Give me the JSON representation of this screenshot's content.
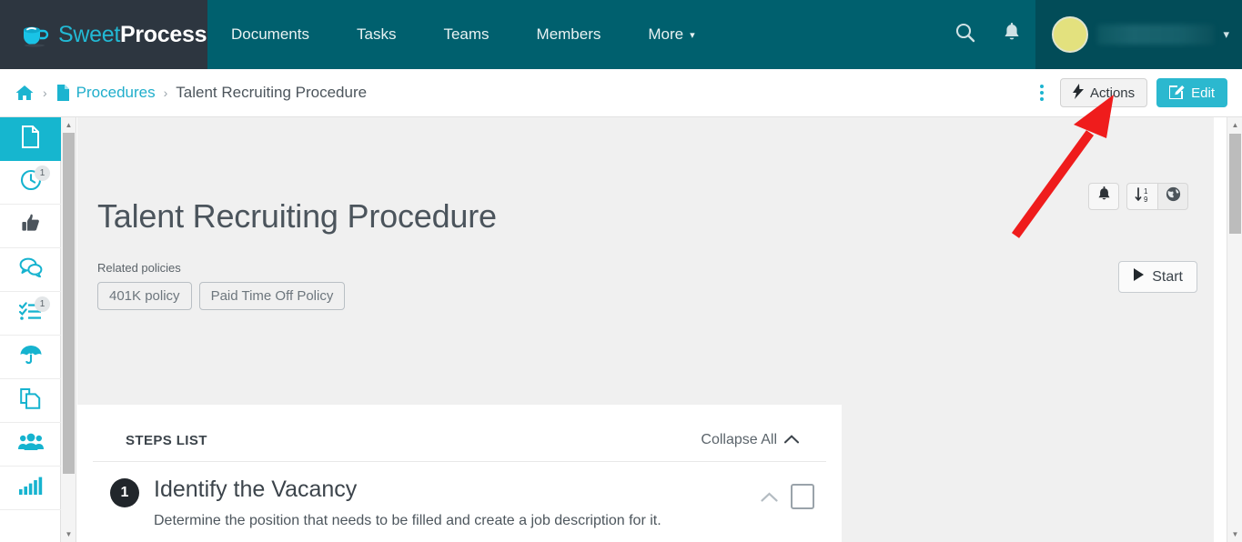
{
  "brand": {
    "logo_icon": "coffee-cup-icon",
    "name_part1": "Sweet",
    "name_part2": "Process",
    "accent_teal": "#00606e",
    "accent_cyan": "#22b9d4",
    "logo_bg": "#2d3640"
  },
  "topnav": {
    "items": [
      {
        "label": "Documents"
      },
      {
        "label": "Tasks"
      },
      {
        "label": "Teams"
      },
      {
        "label": "Members"
      },
      {
        "label": "More",
        "has_chevron": true,
        "chevron": "▾"
      }
    ],
    "search_icon": "search-icon",
    "notifications_icon": "bell-icon",
    "user": {
      "avatar_color": "#e3e17e",
      "name": "",
      "name_redacted": true,
      "chevron": "▾"
    }
  },
  "breadcrumb": {
    "home_icon": "home-icon",
    "separator": "›",
    "doc_icon": "file-icon",
    "parent_label": "Procedures",
    "current_label": "Talent Recruiting Procedure"
  },
  "header_actions": {
    "kebab_icon": "more-vertical-icon",
    "actions_label": "Actions",
    "actions_icon": "lightning-bolt-icon",
    "edit_label": "Edit",
    "edit_icon": "pencil-square-icon",
    "edit_color": "#2bb8cf"
  },
  "sidebar": {
    "items": [
      {
        "name": "documents",
        "icon": "file-icon",
        "active": true,
        "badge": ""
      },
      {
        "name": "pending-approval",
        "icon": "clock-icon",
        "active": false,
        "badge": "1"
      },
      {
        "name": "approvals",
        "icon": "thumbs-up-icon",
        "active": false,
        "badge": ""
      },
      {
        "name": "comments",
        "icon": "chat-bubbles-icon",
        "active": false,
        "badge": ""
      },
      {
        "name": "tasks",
        "icon": "checklist-icon",
        "active": false,
        "badge": "1"
      },
      {
        "name": "policies",
        "icon": "umbrella-icon",
        "active": false,
        "badge": ""
      },
      {
        "name": "duplicate",
        "icon": "copy-pages-icon",
        "active": false,
        "badge": ""
      },
      {
        "name": "teams",
        "icon": "people-icon",
        "active": false,
        "badge": ""
      },
      {
        "name": "reports",
        "icon": "bar-chart-icon",
        "active": false,
        "badge": ""
      }
    ]
  },
  "document": {
    "title": "Talent Recruiting Procedure",
    "related_policies_label": "Related policies",
    "related_policies": [
      {
        "label": "401K policy"
      },
      {
        "label": "Paid Time Off Policy"
      }
    ],
    "tools": [
      {
        "name": "notify",
        "icon": "bell-icon"
      },
      {
        "name": "sort-order",
        "icon": "sort-numeric-down-icon"
      },
      {
        "name": "visibility",
        "icon": "globe-icon",
        "active": true
      }
    ],
    "start_label": "Start",
    "start_icon": "play-icon"
  },
  "steps": {
    "header": "STEPS LIST",
    "collapse_all_label": "Collapse All",
    "collapse_all_icon": "chevron-up-icon",
    "list": [
      {
        "number": "1",
        "title": "Identify the Vacancy",
        "description": "Determine the position that needs to be filled and create a job description for it.",
        "collapse_icon": "chevron-up-icon",
        "checkbox_checked": false
      }
    ]
  },
  "scrollbars": {
    "up_arrow": "▲",
    "down_arrow": "▼"
  },
  "annotation": {
    "type": "arrow",
    "color": "#ef1c1c",
    "points_to": "actions-button"
  }
}
